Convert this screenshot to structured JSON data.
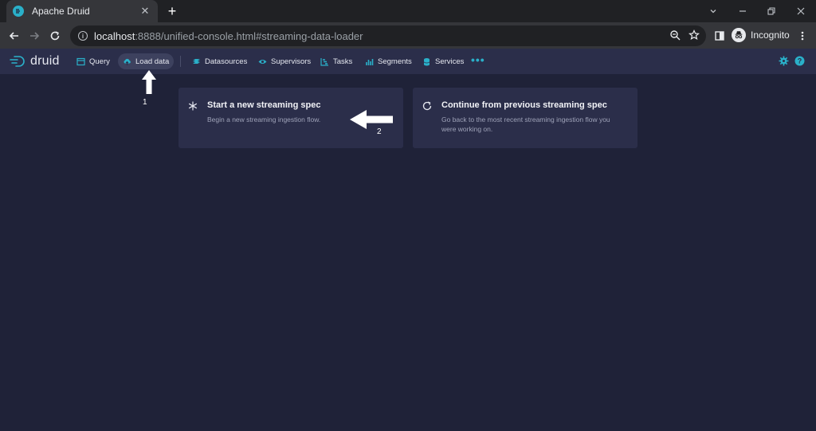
{
  "browser": {
    "tab_title": "Apache Druid",
    "url_host": "localhost",
    "url_path": ":8888/unified-console.html#streaming-data-loader",
    "profile_label": "Incognito"
  },
  "druid": {
    "logo_text": "druid",
    "nav": [
      {
        "label": "Query",
        "icon": "query-icon"
      },
      {
        "label": "Load data",
        "icon": "cloud-upload-icon",
        "active": true
      },
      {
        "label": "Datasources",
        "icon": "database-icon"
      },
      {
        "label": "Supervisors",
        "icon": "eye-icon"
      },
      {
        "label": "Tasks",
        "icon": "gantt-icon"
      },
      {
        "label": "Segments",
        "icon": "stacked-bars-icon"
      },
      {
        "label": "Services",
        "icon": "cylinder-icon"
      }
    ],
    "more_label": "•••"
  },
  "cards": [
    {
      "title": "Start a new streaming spec",
      "description": "Begin a new streaming ingestion flow.",
      "icon": "asterisk-icon"
    },
    {
      "title": "Continue from previous streaming spec",
      "description": "Go back to the most recent streaming ingestion flow you were working on.",
      "icon": "refresh-icon"
    }
  ],
  "annotations": {
    "step1": "1",
    "step2": "2"
  },
  "colors": {
    "page_bg": "#1f2238",
    "header_bg": "#2b2e4a",
    "accent": "#2ab0c9"
  }
}
